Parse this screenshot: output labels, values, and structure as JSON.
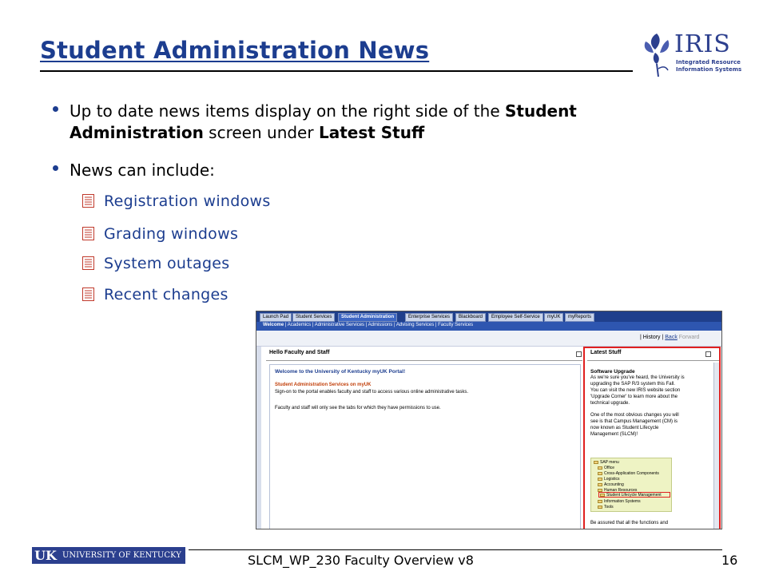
{
  "slide": {
    "title": "Student Administration News",
    "bullets": {
      "b1_part1": "Up to date news items display on the right side of the ",
      "b1_bold1": "Student Administration",
      "b1_part2": " screen under ",
      "b1_bold2": "Latest Stuff",
      "b2": "News can include:"
    },
    "sub_items": [
      "Registration windows",
      "Grading windows",
      "System outages",
      "Recent changes"
    ]
  },
  "logo": {
    "name": "IRIS",
    "tagline_1": "Integrated Resource",
    "tagline_2": "Information Systems"
  },
  "portal": {
    "top_tabs": [
      "Launch Pad",
      "Student Services",
      "Student Administration",
      "Enterprise Services",
      "Blackboard",
      "Employee Self-Service",
      "myUK",
      "myReports"
    ],
    "active_tab": "Student Administration",
    "sub_nav": {
      "active": "Welcome",
      "rest": "| Academics | Administrative Services | Admissions | Advising Services | Faculty Services"
    },
    "history": {
      "label": "History",
      "back": "Back",
      "forward": "Forward"
    },
    "left_pane": {
      "header": "Hello Faculty and Staff",
      "welcome_title": "Welcome to the University of Kentucky myUK Portal!",
      "sub_title": "Student Administration Services on myUK",
      "line1": "Sign-on to the portal enables faculty and staff to access various online administrative tasks.",
      "line2": "Faculty and staff will only see the tabs for which they have permissions to use."
    },
    "right_pane": {
      "header": "Latest Stuff",
      "news_title": "Software Upgrade",
      "lines": [
        "As we're sure you've heard, the University is",
        "upgrading the SAP R/3 system this Fall.",
        "You can visit the new IRIS website section",
        "'Upgrade Corner' to learn more about the",
        "technical upgrade."
      ],
      "lines2": [
        "One of the most obvious changes you will",
        "see is that Campus Management (CM) is",
        "now known as Student Lifecycle",
        "Management (SLCM)!"
      ],
      "tree": [
        "SAP menu",
        "Office",
        "Cross-Application Components",
        "Logistics",
        "Accounting",
        "Human Resources",
        "Student Lifecycle Management",
        "Information Systems",
        "Tools"
      ],
      "footer_line": "Be assured that all the functions and"
    }
  },
  "footer": {
    "uk_mark": "UK",
    "university": "UNIVERSITY OF KENTUCKY",
    "doc_title": "SLCM_WP_230 Faculty Overview v8",
    "page_number": "16"
  },
  "colors": {
    "title_blue": "#1c3d8f",
    "nav_dark": "#1f3f8c",
    "highlight_red": "#e02020",
    "uk_blue": "#2b3f8e"
  },
  "icons": {
    "bullet": "round-dot",
    "sub_item": "document-lines-icon",
    "tree_folder": "folder-icon"
  }
}
